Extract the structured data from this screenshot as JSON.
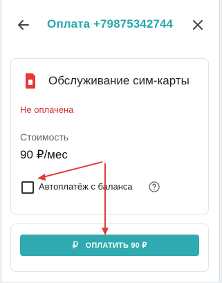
{
  "header": {
    "title": "Оплата +79875342744",
    "back_icon": "arrow-left-icon",
    "close_icon": "close-icon"
  },
  "service": {
    "icon": "sim-card-icon",
    "name": "Обслуживание сим-карты",
    "status": "Не оплачена",
    "cost_label": "Стоимость",
    "cost_value": "90 ₽/мес"
  },
  "autopay": {
    "label": "Автоплатёж с баланса",
    "checked": false,
    "help_icon": "question-circle-icon"
  },
  "pay_button": {
    "icon": "ruble-icon",
    "icon_glyph": "₽",
    "label": "ОПЛАТИТЬ 90 ₽"
  },
  "colors": {
    "accent": "#29a8ab",
    "button": "#2faab0",
    "status_error": "#d32f2f",
    "annotation_arrow": "#e53935"
  }
}
